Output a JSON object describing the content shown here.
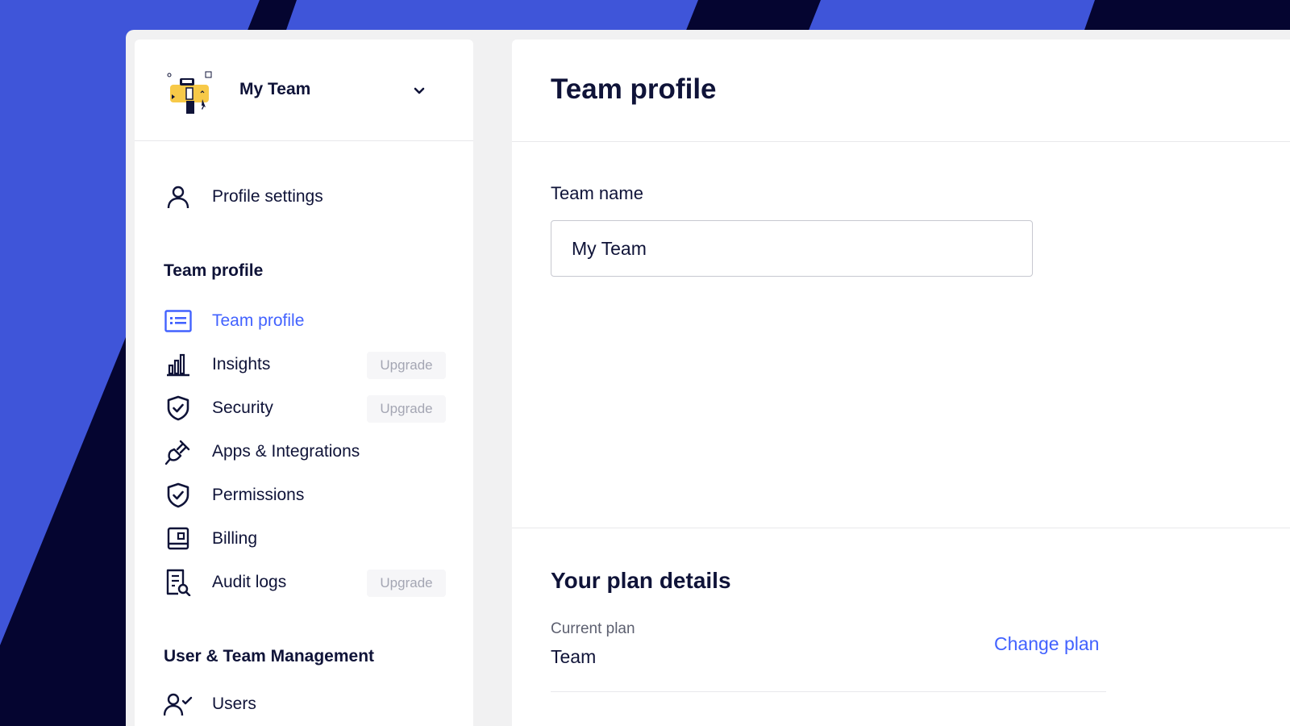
{
  "colors": {
    "background_blue": "#3f55d9",
    "background_navy": "#050530",
    "accent": "#4262ff",
    "text_dark": "#0f1338"
  },
  "team_switcher": {
    "logo_icon": "team-illustration-icon",
    "name": "My Team",
    "chevron_icon": "chevron-down-icon"
  },
  "sidebar": {
    "profile_settings": {
      "label": "Profile settings",
      "icon": "user-icon"
    },
    "team_profile_section": {
      "title": "Team profile",
      "items": [
        {
          "label": "Team profile",
          "icon": "id-card-icon",
          "active": true
        },
        {
          "label": "Insights",
          "icon": "bar-chart-icon",
          "badge": "Upgrade"
        },
        {
          "label": "Security",
          "icon": "shield-check-icon",
          "badge": "Upgrade"
        },
        {
          "label": "Apps & Integrations",
          "icon": "plug-icon"
        },
        {
          "label": "Permissions",
          "icon": "shield-check-icon"
        },
        {
          "label": "Billing",
          "icon": "billing-icon"
        },
        {
          "label": "Audit logs",
          "icon": "document-search-icon",
          "badge": "Upgrade"
        }
      ]
    },
    "user_management_section": {
      "title": "User & Team Management",
      "items": [
        {
          "label": "Users",
          "icon": "user-check-icon"
        }
      ]
    }
  },
  "main": {
    "title": "Team profile",
    "team_name_label": "Team name",
    "team_name_value": "My Team",
    "plan": {
      "title": "Your plan details",
      "current_plan_label": "Current plan",
      "current_plan_value": "Team",
      "change_plan_label": "Change plan"
    }
  }
}
